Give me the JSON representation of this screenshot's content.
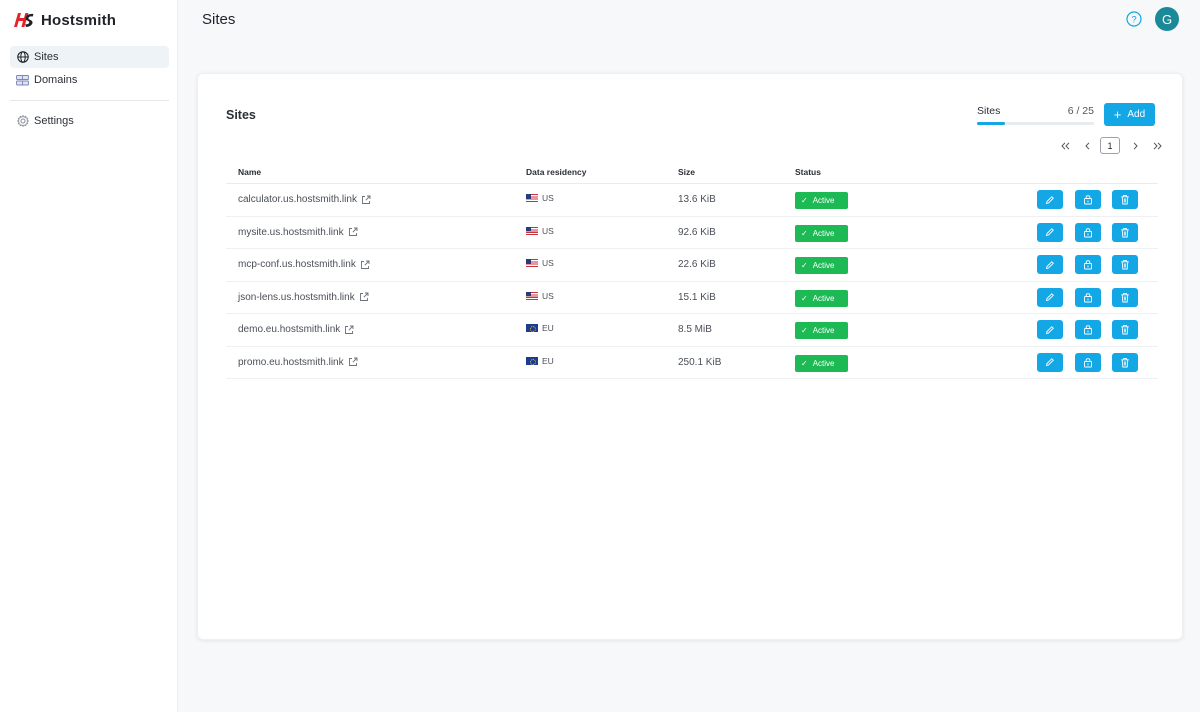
{
  "app": {
    "name": "Hostsmith",
    "brand_color": "#e3242b"
  },
  "sidebar": {
    "items": [
      {
        "label": "Sites",
        "icon": "globe-icon",
        "active": true
      },
      {
        "label": "Domains",
        "icon": "server-icon",
        "active": false
      }
    ],
    "footer_items": [
      {
        "label": "Settings",
        "icon": "gear-icon"
      }
    ]
  },
  "header": {
    "title": "Sites",
    "help_icon": "question-circle-icon",
    "avatar_initial": "G",
    "avatar_color": "#1a8a98"
  },
  "card": {
    "title": "Sites",
    "quota": {
      "label": "Sites",
      "count_text": "6 / 25",
      "used": 6,
      "limit": 25
    },
    "add_button": {
      "label": "Add",
      "icon": "plus-icon"
    },
    "pagination": {
      "first_icon": "double-chevron-left-icon",
      "prev_icon": "chevron-left-icon",
      "current_page": "1",
      "next_icon": "chevron-right-icon",
      "last_icon": "double-chevron-right-icon"
    },
    "accent_color": "#13a7e6",
    "status_color": "#1db954"
  },
  "table": {
    "columns": [
      "Name",
      "Data residency",
      "Size",
      "Status"
    ],
    "rows": [
      {
        "name": "calculator.us.hostsmith.link",
        "region": "US",
        "size": "13.6 KiB",
        "status": "Active"
      },
      {
        "name": "mysite.us.hostsmith.link",
        "region": "US",
        "size": "92.6 KiB",
        "status": "Active"
      },
      {
        "name": "mcp-conf.us.hostsmith.link",
        "region": "US",
        "size": "22.6 KiB",
        "status": "Active"
      },
      {
        "name": "json-lens.us.hostsmith.link",
        "region": "US",
        "size": "15.1 KiB",
        "status": "Active"
      },
      {
        "name": "demo.eu.hostsmith.link",
        "region": "EU",
        "size": "8.5 MiB",
        "status": "Active"
      },
      {
        "name": "promo.eu.hostsmith.link",
        "region": "EU",
        "size": "250.1 KiB",
        "status": "Active"
      }
    ],
    "row_actions": [
      "pencil-icon",
      "lock-icon",
      "trash-icon"
    ]
  }
}
